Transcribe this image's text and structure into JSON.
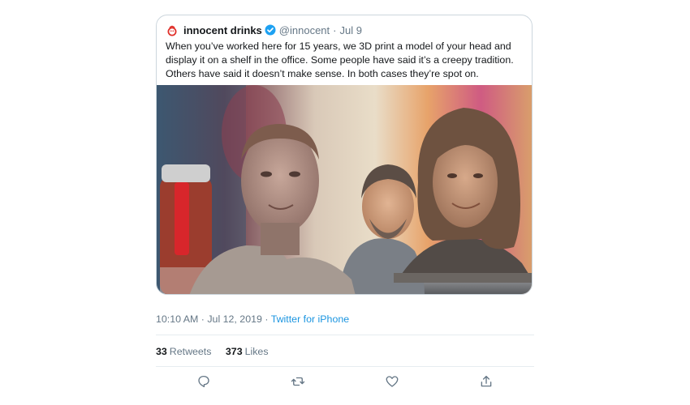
{
  "tweet": {
    "author": {
      "name": "innocent drinks",
      "handle": "@innocent",
      "verified": true
    },
    "quote_date": "Jul 9",
    "text": "When you’ve worked here for 15 years, we 3D print a model of your head and display it on a shelf in the office. Some people have said it’s a creepy tradition. Others have said it doesn’t make sense. In both cases they’re spot on.",
    "image_description_icon": "photo-of-3d-printed-heads",
    "timestamp": "10:10 AM · Jul 12, 2019",
    "meta_separator": "·",
    "source": "Twitter for iPhone",
    "stats": {
      "retweets_count": "33",
      "retweets_label": "Retweets",
      "likes_count": "373",
      "likes_label": "Likes"
    },
    "actions": {
      "reply_icon": "reply-icon",
      "retweet_icon": "retweet-icon",
      "like_icon": "heart-icon",
      "share_icon": "share-icon"
    }
  },
  "colors": {
    "link": "#1b95e0",
    "secondary_text": "#657786",
    "border": "#ccd6dd",
    "verified": "#1da1f2",
    "brand_red": "#e0302a"
  }
}
